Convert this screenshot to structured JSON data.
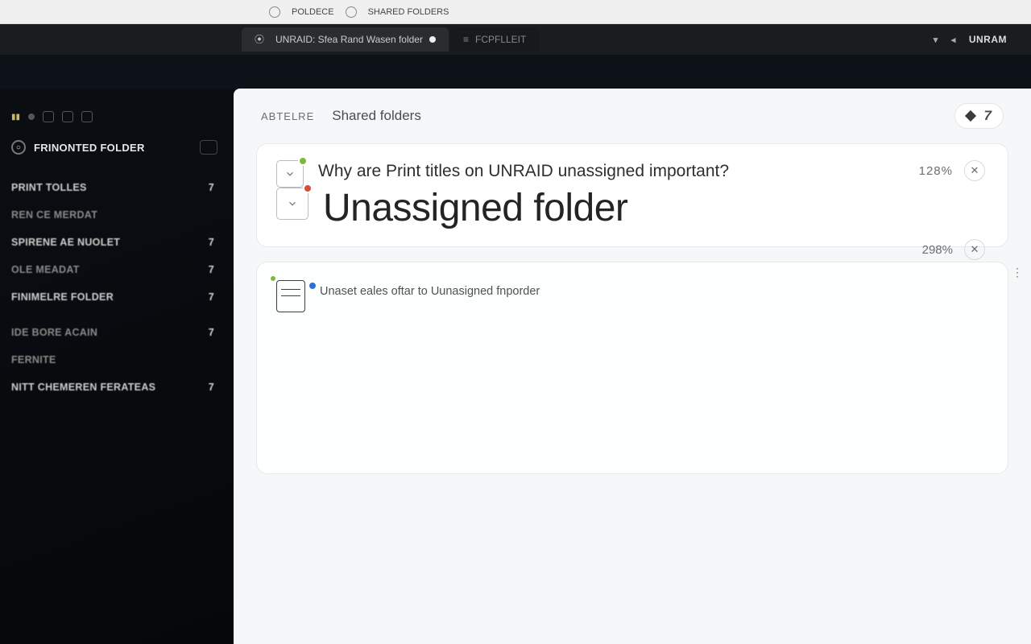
{
  "chrome": {
    "menu_left_1": "POLDECE",
    "menu_left_2": "SHARED FOLDERS",
    "brand_right": "UNRAM"
  },
  "tabs": {
    "active": "UNRAID: Sfea Rand Wasen folder",
    "inactive": "FCPFLLEIT"
  },
  "sidebar": {
    "header": "FRINONTED FOLDER",
    "items": [
      {
        "label": "PRINT TOLLES",
        "count": "7"
      },
      {
        "label": "REN CE MERDAT",
        "count": ""
      },
      {
        "label": "SPIRENE AE NUOLET",
        "count": "7"
      },
      {
        "label": "OLE MEADAT",
        "count": "7"
      },
      {
        "label": "FINIMELRE FOLDER",
        "count": "7"
      },
      {
        "label": "IDE BORE ACAIN",
        "count": "7"
      },
      {
        "label": "FERNITE",
        "count": ""
      },
      {
        "label": "NITT CHEMEREN FERATEAS",
        "count": "7"
      }
    ]
  },
  "main": {
    "tab_secondary": "ABTELRE",
    "tab_primary": "Shared folders",
    "pill_seven": "7",
    "row1": {
      "text": "Why are Print titles on UNRAID unassigned important?",
      "pct": "128%"
    },
    "row2": {
      "title": "Unassigned folder",
      "pct": "298%"
    },
    "card2": {
      "text": "Unaset eales oftar to Uunasigned fnporder"
    }
  }
}
